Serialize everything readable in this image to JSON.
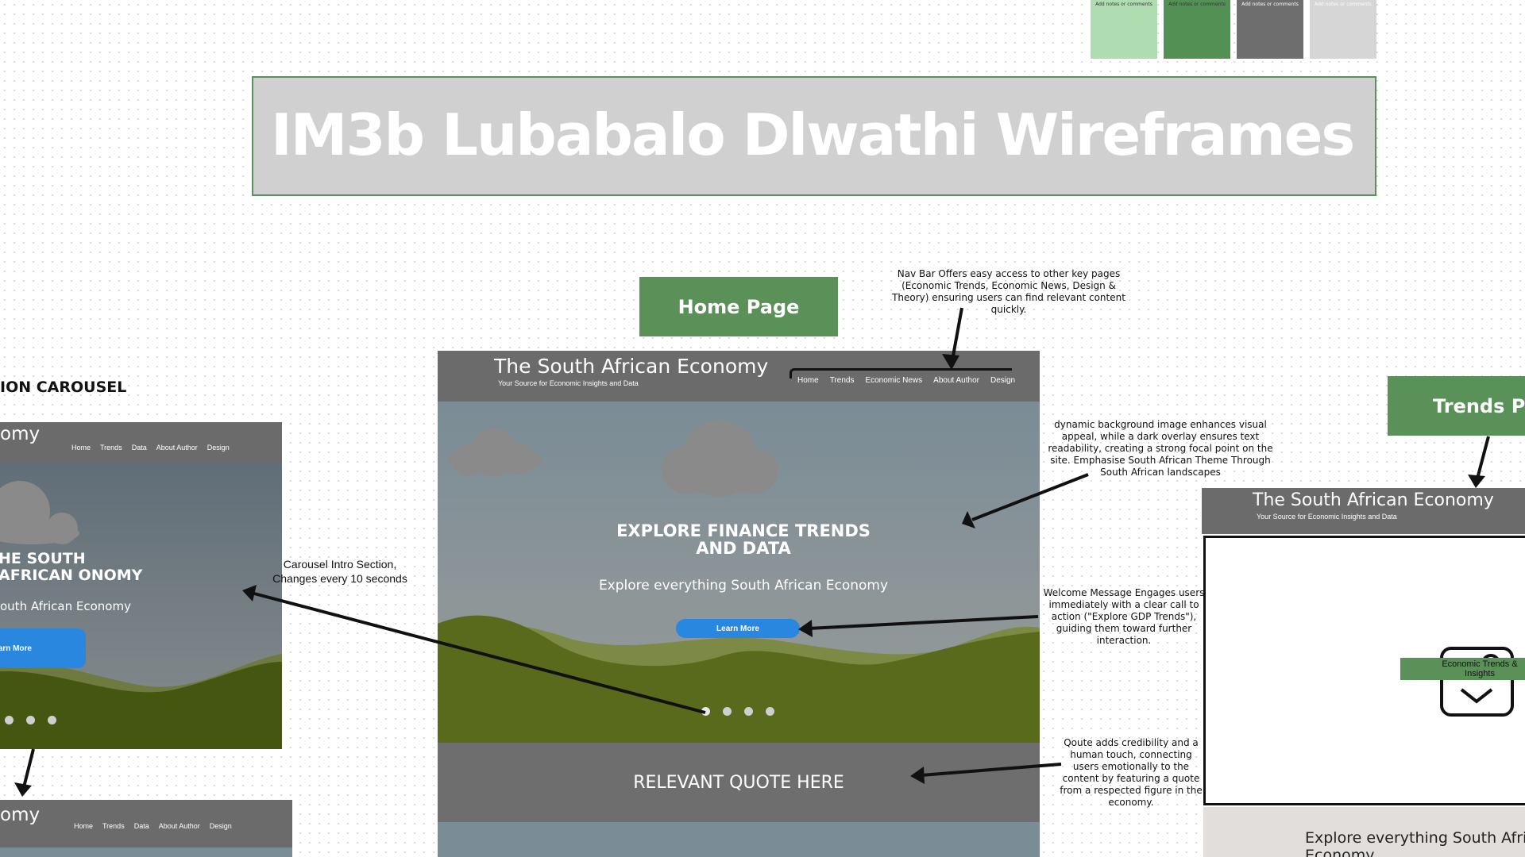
{
  "sticky_notes": [
    {
      "text": "Add notes or comments",
      "color": "#b0dcb2"
    },
    {
      "text": "Add notes or comments",
      "color": "#539054"
    },
    {
      "text": "Add notes or comments",
      "color": "#6e6e6e"
    },
    {
      "text": "Add notes or comments",
      "color": "#d6d6d6"
    }
  ],
  "board_title": "IM3b Lubabalo Dlwathi Wireframes",
  "labels": {
    "home_page": "Home Page",
    "trends_page": "Trends Page",
    "carousel_section": "ION CAROUSEL"
  },
  "site": {
    "title": "The South African Economy",
    "subtitle": "Your Source for Economic Insights and Data",
    "nav_home": [
      "Home",
      "Trends",
      "Economic News",
      "About Author",
      "Design"
    ],
    "nav_alt": [
      "Home",
      "Trends",
      "Data",
      "About Author",
      "Design"
    ]
  },
  "hero": {
    "heading": "EXPLORE FINANCE TRENDS AND DATA",
    "subheading": "Explore everything South African Economy",
    "button": "Learn More"
  },
  "quote": "RELEVANT QUOTE HERE",
  "left_frame": {
    "title": "omy",
    "heading": "HE SOUTH AFRICAN ONOMY",
    "sub": "outh African Economy",
    "button": "arn More",
    "bottom_title": "omy"
  },
  "trends_frame": {
    "placeholder_label": "Economic Trends & Insights",
    "explore": "Explore everything South African Economy"
  },
  "annotations": {
    "nav": "Nav Bar Offers easy access to other key pages (Economic Trends, Economic News, Design & Theory) ensuring users can find relevant content quickly.",
    "background": "dynamic background image enhances visual appeal, while a dark overlay ensures text readability, creating a strong focal point on the site. Emphasise South African Theme Through South African landscapes",
    "welcome": "Welcome Message Engages users immediately with a clear call to action (\"Explore GDP Trends\"), guiding them toward further interaction.",
    "quote": "Qoute adds credibility and a human touch, connecting users emotionally to the content by featuring a quote from a respected figure in the economy.",
    "carousel": "Carousel Intro Section, Changes every 10 seconds"
  },
  "colors": {
    "green": "#5a9158",
    "header_gray": "#6b6b6b",
    "hero_sky": "#7a8c96",
    "hill_dark": "#5a6a1c",
    "hill_light": "#7d8a45",
    "button_blue": "#2a87e0"
  }
}
